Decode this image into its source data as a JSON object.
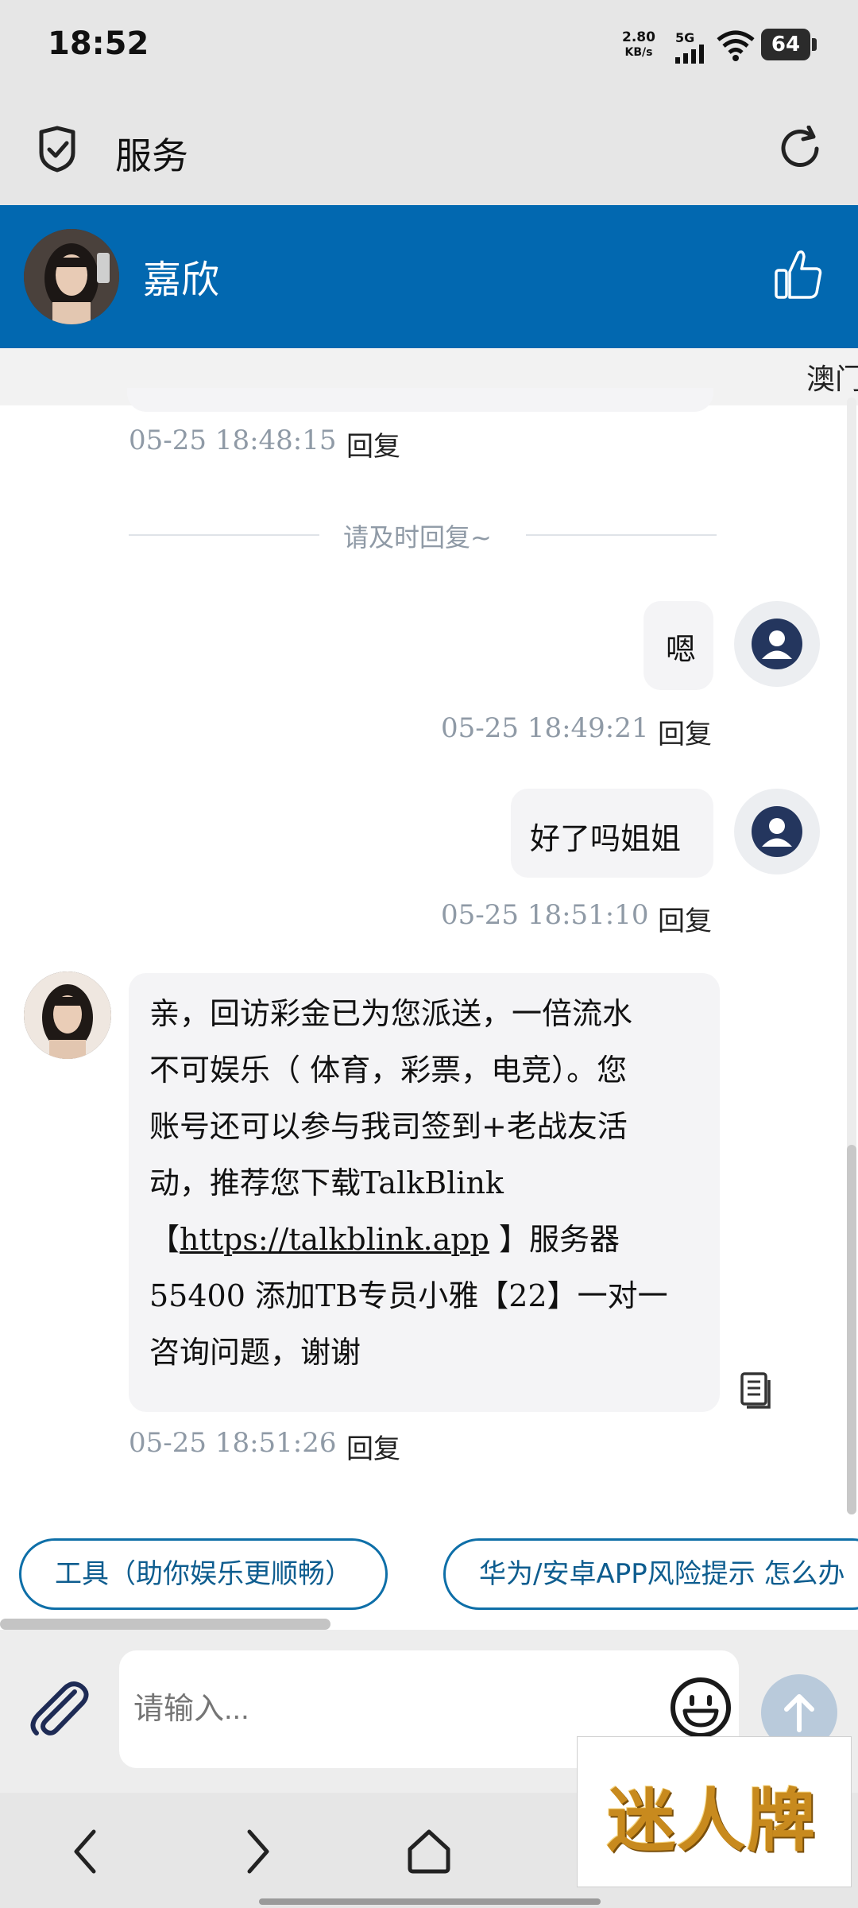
{
  "status_bar": {
    "time": "18:52",
    "net_speed_value": "2.80",
    "net_speed_unit": "KB/s",
    "signal_label": "5G",
    "battery": "64"
  },
  "app_bar": {
    "title": "服务",
    "shield_icon": "shield-check-icon",
    "refresh_icon": "refresh-icon"
  },
  "chat_header": {
    "name": "嘉欣",
    "like_icon": "thumbs-up-icon"
  },
  "marquee": {
    "text": "澳门"
  },
  "messages": [
    {
      "side": "agent",
      "time": "05-25 18:48:15",
      "reply": "回复"
    },
    {
      "side": "system",
      "text": "请及时回复~"
    },
    {
      "side": "user",
      "text": "嗯",
      "time": "05-25 18:49:21",
      "reply": "回复"
    },
    {
      "side": "user",
      "text": "好了吗姐姐",
      "time": "05-25 18:51:10",
      "reply": "回复"
    },
    {
      "side": "agent",
      "lines": [
        "亲，回访彩金已为您派送，一倍流水",
        "不可娱乐（ 体育，彩票，电竞）。您",
        "账号还可以参与我司签到+老战友活",
        "动，推荐您下载TalkBlink",
        "55400 添加TB专员小雅【22】一对一",
        "咨询问题，谢谢"
      ],
      "link_prefix": "【",
      "link": "https://talkblink.app",
      "link_suffix": " 】服务器",
      "time": "05-25 18:51:26",
      "reply": "回复"
    }
  ],
  "quick_replies": [
    "工具（助你娱乐更顺畅）",
    "华为/安卓APP风险提示 怎么办"
  ],
  "input": {
    "placeholder": "请输入..."
  },
  "watermark": {
    "text": "迷人牌"
  },
  "colors": {
    "brand_blue": "#0268b0",
    "pill_border": "#0e6fa8",
    "timestamp_gray": "#8f9aa6",
    "user_avatar_navy": "#24365e"
  }
}
